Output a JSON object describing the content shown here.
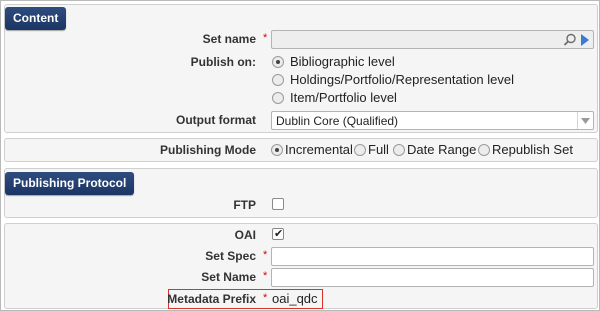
{
  "content_section": {
    "title": "Content",
    "set_name_label": "Set name",
    "set_name_value": "",
    "required_mark": "*",
    "publish_on_label": "Publish on:",
    "publish_on_options": [
      {
        "label": "Bibliographic level",
        "checked": true
      },
      {
        "label": "Holdings/Portfolio/Representation level",
        "checked": false
      },
      {
        "label": "Item/Portfolio level",
        "checked": false
      }
    ],
    "output_format_label": "Output format",
    "output_format_value": "Dublin Core (Qualified)",
    "icons": [
      "search-icon",
      "triangle-right-icon",
      "chevron-down-icon"
    ]
  },
  "publishing_mode": {
    "label": "Publishing Mode",
    "options": [
      {
        "label": "Incremental",
        "checked": true
      },
      {
        "label": "Full",
        "checked": false
      },
      {
        "label": "Date Range",
        "checked": false
      },
      {
        "label": "Republish Set",
        "checked": false
      }
    ]
  },
  "publishing_protocol": {
    "title": "Publishing Protocol",
    "ftp_label": "FTP",
    "ftp_checked": false,
    "oai_label": "OAI",
    "oai_checked": true,
    "set_spec_label": "Set Spec",
    "set_spec_value": "",
    "set_name_label": "Set Name",
    "set_name_value": "",
    "metadata_prefix_label": "Metadata Prefix",
    "metadata_prefix_value": "oai_qdc"
  },
  "colors": {
    "header_bg": "#1b3564",
    "required": "#dd0000",
    "highlight_border": "#d9342b"
  }
}
